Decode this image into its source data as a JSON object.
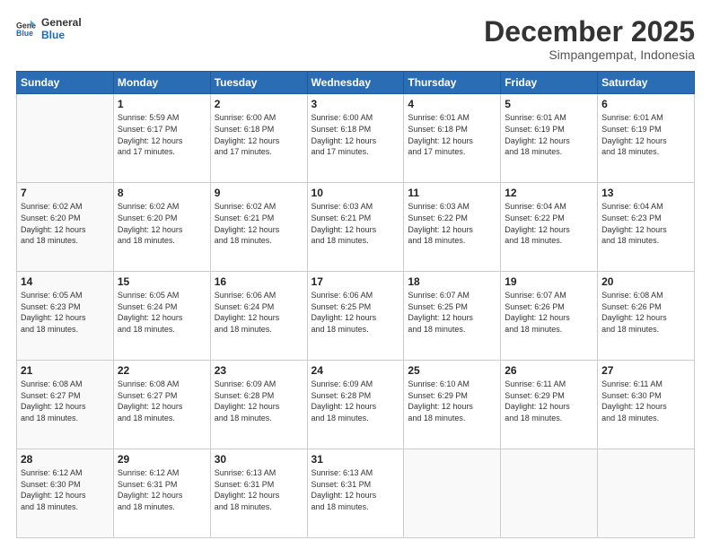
{
  "logo": {
    "line1": "General",
    "line2": "Blue"
  },
  "title": "December 2025",
  "subtitle": "Simpangempat, Indonesia",
  "days_header": [
    "Sunday",
    "Monday",
    "Tuesday",
    "Wednesday",
    "Thursday",
    "Friday",
    "Saturday"
  ],
  "weeks": [
    [
      {
        "day": "",
        "info": ""
      },
      {
        "day": "1",
        "info": "Sunrise: 5:59 AM\nSunset: 6:17 PM\nDaylight: 12 hours\nand 17 minutes."
      },
      {
        "day": "2",
        "info": "Sunrise: 6:00 AM\nSunset: 6:18 PM\nDaylight: 12 hours\nand 17 minutes."
      },
      {
        "day": "3",
        "info": "Sunrise: 6:00 AM\nSunset: 6:18 PM\nDaylight: 12 hours\nand 17 minutes."
      },
      {
        "day": "4",
        "info": "Sunrise: 6:01 AM\nSunset: 6:18 PM\nDaylight: 12 hours\nand 17 minutes."
      },
      {
        "day": "5",
        "info": "Sunrise: 6:01 AM\nSunset: 6:19 PM\nDaylight: 12 hours\nand 18 minutes."
      },
      {
        "day": "6",
        "info": "Sunrise: 6:01 AM\nSunset: 6:19 PM\nDaylight: 12 hours\nand 18 minutes."
      }
    ],
    [
      {
        "day": "7",
        "info": "Sunrise: 6:02 AM\nSunset: 6:20 PM\nDaylight: 12 hours\nand 18 minutes."
      },
      {
        "day": "8",
        "info": "Sunrise: 6:02 AM\nSunset: 6:20 PM\nDaylight: 12 hours\nand 18 minutes."
      },
      {
        "day": "9",
        "info": "Sunrise: 6:02 AM\nSunset: 6:21 PM\nDaylight: 12 hours\nand 18 minutes."
      },
      {
        "day": "10",
        "info": "Sunrise: 6:03 AM\nSunset: 6:21 PM\nDaylight: 12 hours\nand 18 minutes."
      },
      {
        "day": "11",
        "info": "Sunrise: 6:03 AM\nSunset: 6:22 PM\nDaylight: 12 hours\nand 18 minutes."
      },
      {
        "day": "12",
        "info": "Sunrise: 6:04 AM\nSunset: 6:22 PM\nDaylight: 12 hours\nand 18 minutes."
      },
      {
        "day": "13",
        "info": "Sunrise: 6:04 AM\nSunset: 6:23 PM\nDaylight: 12 hours\nand 18 minutes."
      }
    ],
    [
      {
        "day": "14",
        "info": "Sunrise: 6:05 AM\nSunset: 6:23 PM\nDaylight: 12 hours\nand 18 minutes."
      },
      {
        "day": "15",
        "info": "Sunrise: 6:05 AM\nSunset: 6:24 PM\nDaylight: 12 hours\nand 18 minutes."
      },
      {
        "day": "16",
        "info": "Sunrise: 6:06 AM\nSunset: 6:24 PM\nDaylight: 12 hours\nand 18 minutes."
      },
      {
        "day": "17",
        "info": "Sunrise: 6:06 AM\nSunset: 6:25 PM\nDaylight: 12 hours\nand 18 minutes."
      },
      {
        "day": "18",
        "info": "Sunrise: 6:07 AM\nSunset: 6:25 PM\nDaylight: 12 hours\nand 18 minutes."
      },
      {
        "day": "19",
        "info": "Sunrise: 6:07 AM\nSunset: 6:26 PM\nDaylight: 12 hours\nand 18 minutes."
      },
      {
        "day": "20",
        "info": "Sunrise: 6:08 AM\nSunset: 6:26 PM\nDaylight: 12 hours\nand 18 minutes."
      }
    ],
    [
      {
        "day": "21",
        "info": "Sunrise: 6:08 AM\nSunset: 6:27 PM\nDaylight: 12 hours\nand 18 minutes."
      },
      {
        "day": "22",
        "info": "Sunrise: 6:08 AM\nSunset: 6:27 PM\nDaylight: 12 hours\nand 18 minutes."
      },
      {
        "day": "23",
        "info": "Sunrise: 6:09 AM\nSunset: 6:28 PM\nDaylight: 12 hours\nand 18 minutes."
      },
      {
        "day": "24",
        "info": "Sunrise: 6:09 AM\nSunset: 6:28 PM\nDaylight: 12 hours\nand 18 minutes."
      },
      {
        "day": "25",
        "info": "Sunrise: 6:10 AM\nSunset: 6:29 PM\nDaylight: 12 hours\nand 18 minutes."
      },
      {
        "day": "26",
        "info": "Sunrise: 6:11 AM\nSunset: 6:29 PM\nDaylight: 12 hours\nand 18 minutes."
      },
      {
        "day": "27",
        "info": "Sunrise: 6:11 AM\nSunset: 6:30 PM\nDaylight: 12 hours\nand 18 minutes."
      }
    ],
    [
      {
        "day": "28",
        "info": "Sunrise: 6:12 AM\nSunset: 6:30 PM\nDaylight: 12 hours\nand 18 minutes."
      },
      {
        "day": "29",
        "info": "Sunrise: 6:12 AM\nSunset: 6:31 PM\nDaylight: 12 hours\nand 18 minutes."
      },
      {
        "day": "30",
        "info": "Sunrise: 6:13 AM\nSunset: 6:31 PM\nDaylight: 12 hours\nand 18 minutes."
      },
      {
        "day": "31",
        "info": "Sunrise: 6:13 AM\nSunset: 6:31 PM\nDaylight: 12 hours\nand 18 minutes."
      },
      {
        "day": "",
        "info": ""
      },
      {
        "day": "",
        "info": ""
      },
      {
        "day": "",
        "info": ""
      }
    ]
  ]
}
